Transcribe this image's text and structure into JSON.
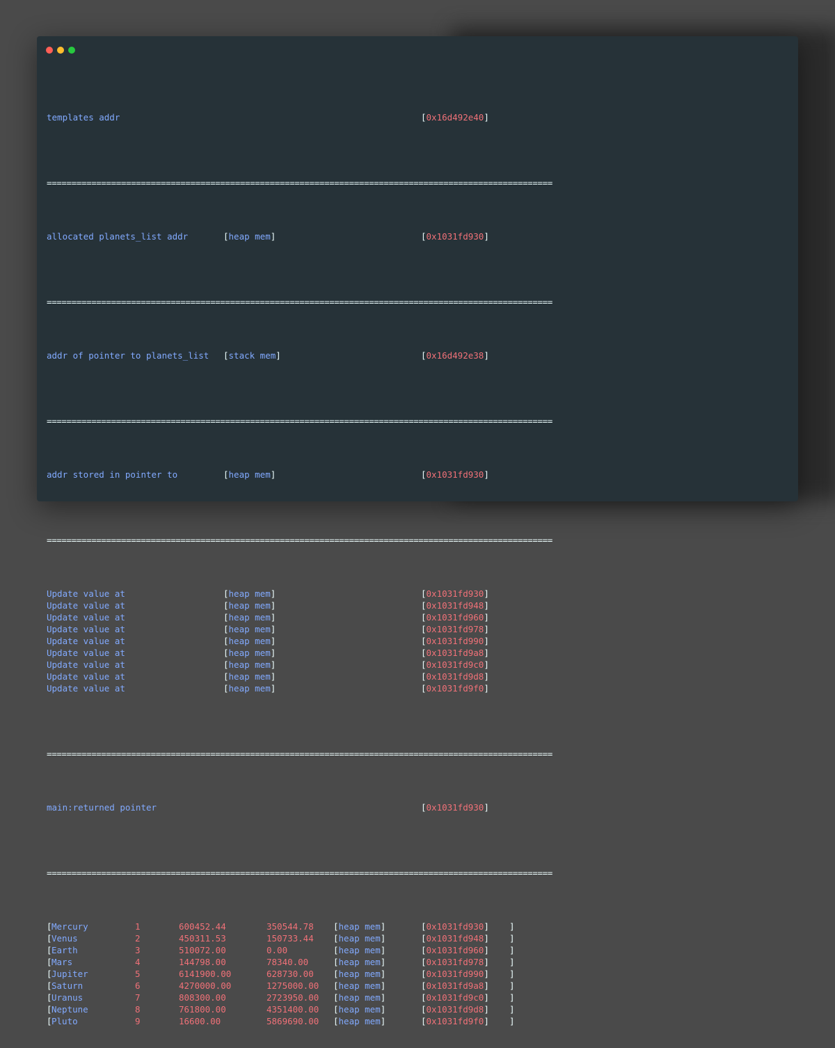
{
  "window": {
    "controls": [
      "close",
      "minimize",
      "maximize"
    ]
  },
  "separator": "======================================================================================================",
  "header_lines": [
    {
      "label": "templates addr",
      "mem": "",
      "addr": "0x16d492e40"
    },
    {
      "label": "allocated planets_list addr",
      "mem": "heap mem",
      "addr": "0x1031fd930"
    },
    {
      "label": "addr of pointer to planets_list",
      "mem": "stack mem",
      "addr": "0x16d492e38"
    },
    {
      "label": "addr stored in pointer to",
      "mem": "heap mem",
      "addr": "0x1031fd930"
    }
  ],
  "updates": [
    {
      "label": "Update value at",
      "mem": "heap mem",
      "addr": "0x1031fd930"
    },
    {
      "label": "Update value at",
      "mem": "heap mem",
      "addr": "0x1031fd948"
    },
    {
      "label": "Update value at",
      "mem": "heap mem",
      "addr": "0x1031fd960"
    },
    {
      "label": "Update value at",
      "mem": "heap mem",
      "addr": "0x1031fd978"
    },
    {
      "label": "Update value at",
      "mem": "heap mem",
      "addr": "0x1031fd990"
    },
    {
      "label": "Update value at",
      "mem": "heap mem",
      "addr": "0x1031fd9a8"
    },
    {
      "label": "Update value at",
      "mem": "heap mem",
      "addr": "0x1031fd9c0"
    },
    {
      "label": "Update value at",
      "mem": "heap mem",
      "addr": "0x1031fd9d8"
    },
    {
      "label": "Update value at",
      "mem": "heap mem",
      "addr": "0x1031fd9f0"
    }
  ],
  "returned": {
    "label": "main:returned pointer",
    "addr": "0x1031fd930"
  },
  "planets": [
    {
      "name": "Mercury",
      "id": "1",
      "v1": "600452.44",
      "v2": "350544.78",
      "mem": "heap mem",
      "addr": "0x1031fd930"
    },
    {
      "name": "Venus",
      "id": "2",
      "v1": "450311.53",
      "v2": "150733.44",
      "mem": "heap mem",
      "addr": "0x1031fd948"
    },
    {
      "name": "Earth",
      "id": "3",
      "v1": "510072.00",
      "v2": "0.00",
      "mem": "heap mem",
      "addr": "0x1031fd960"
    },
    {
      "name": "Mars",
      "id": "4",
      "v1": "144798.00",
      "v2": "78340.00",
      "mem": "heap mem",
      "addr": "0x1031fd978"
    },
    {
      "name": "Jupiter",
      "id": "5",
      "v1": "6141900.00",
      "v2": "628730.00",
      "mem": "heap mem",
      "addr": "0x1031fd990"
    },
    {
      "name": "Saturn",
      "id": "6",
      "v1": "4270000.00",
      "v2": "1275000.00",
      "mem": "heap mem",
      "addr": "0x1031fd9a8"
    },
    {
      "name": "Uranus",
      "id": "7",
      "v1": "808300.00",
      "v2": "2723950.00",
      "mem": "heap mem",
      "addr": "0x1031fd9c0"
    },
    {
      "name": "Neptune",
      "id": "8",
      "v1": "761800.00",
      "v2": "4351400.00",
      "mem": "heap mem",
      "addr": "0x1031fd9d8"
    },
    {
      "name": "Pluto",
      "id": "9",
      "v1": "16600.00",
      "v2": "5869690.00",
      "mem": "heap mem",
      "addr": "0x1031fd9f0"
    }
  ],
  "colors": {
    "background": "#263238",
    "label": "#82aaff",
    "address": "#f07178",
    "bracket": "#eeffff"
  }
}
